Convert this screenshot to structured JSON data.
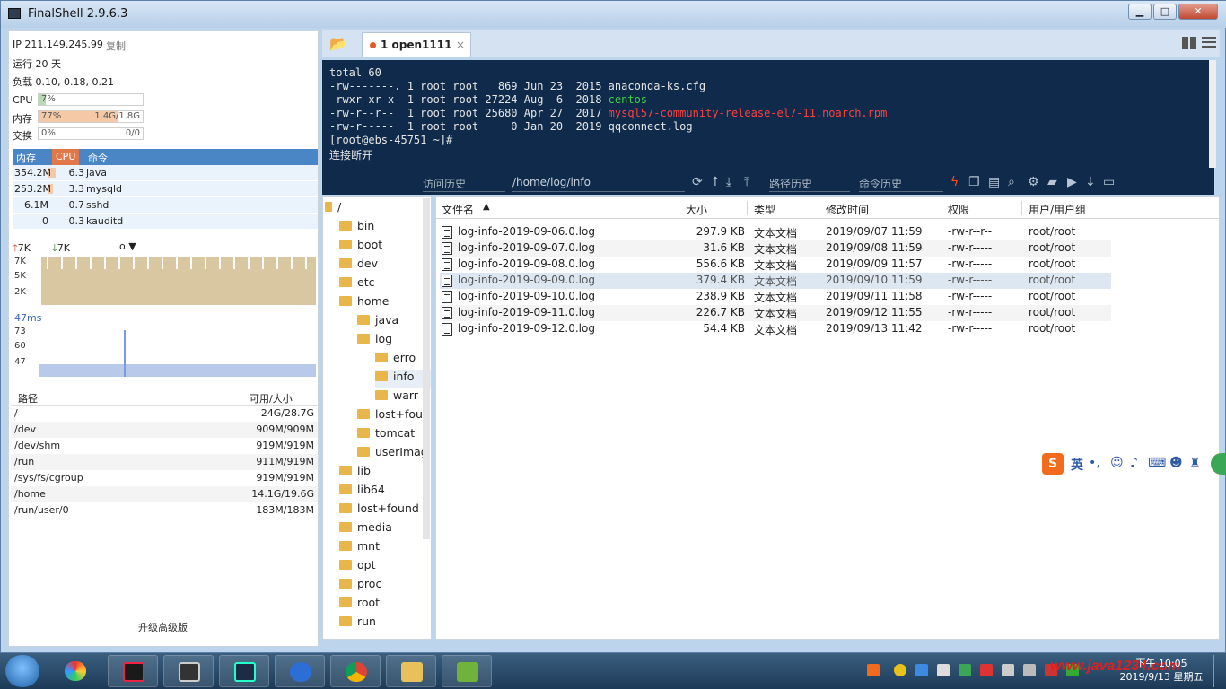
{
  "window": {
    "title": "FinalShell 2.9.6.3"
  },
  "status": {
    "ip": "IP 211.149.245.99",
    "copy": "复制",
    "uptime": "运行 20 天",
    "load": "负载 0.10, 0.18, 0.21",
    "cpu": {
      "label": "CPU",
      "value": "7%",
      "fraction": 0.07
    },
    "mem": {
      "label": "内存",
      "percent": "77%",
      "usage": "1.4G/1.8G",
      "fraction": 0.77
    },
    "swap": {
      "label": "交换",
      "percent": "0%",
      "usage": "0/0",
      "fraction": 0
    }
  },
  "processes": {
    "headers": [
      "内存",
      "CPU",
      "命令"
    ],
    "rows": [
      {
        "mem": "354.2M",
        "cpu": "6.3",
        "cmd": "java"
      },
      {
        "mem": "253.2M",
        "cpu": "3.3",
        "cmd": "mysqld"
      },
      {
        "mem": "6.1M",
        "cpu": "0.7",
        "cmd": "sshd"
      },
      {
        "mem": "0",
        "cpu": "0.3",
        "cmd": "kauditd"
      }
    ]
  },
  "network": {
    "up": "7K",
    "down": "7K",
    "iface": "lo",
    "y_labels": [
      "7K",
      "5K",
      "2K"
    ],
    "ping": "47ms",
    "ping_labels": [
      "73",
      "60",
      "47"
    ]
  },
  "disks": {
    "headers": [
      "路径",
      "可用/大小"
    ],
    "rows": [
      {
        "path": "/",
        "size": "24G/28.7G"
      },
      {
        "path": "/dev",
        "size": "909M/909M"
      },
      {
        "path": "/dev/shm",
        "size": "919M/919M"
      },
      {
        "path": "/run",
        "size": "911M/919M"
      },
      {
        "path": "/sys/fs/cgroup",
        "size": "919M/919M"
      },
      {
        "path": "/home",
        "size": "14.1G/19.6G"
      },
      {
        "path": "/run/user/0",
        "size": "183M/183M"
      }
    ],
    "upgrade": "升级高级版"
  },
  "tab": {
    "label": "1 open1111",
    "close": "×"
  },
  "terminal": {
    "lines": [
      {
        "pre": "total 60",
        "name": "",
        "cls": ""
      },
      {
        "pre": "-rw-------. 1 root root   869 Jun 23  2015 ",
        "name": "anaconda-ks.cfg",
        "cls": ""
      },
      {
        "pre": "-rwxr-xr-x  1 root root 27224 Aug  6  2018 ",
        "name": "centos",
        "cls": "t-green"
      },
      {
        "pre": "-rw-r--r--  1 root root 25680 Apr 27  2017 ",
        "name": "mysql57-community-release-el7-11.noarch.rpm",
        "cls": "t-red"
      },
      {
        "pre": "-rw-r-----  1 root root     0 Jan 20  2019 ",
        "name": "qqconnect.log",
        "cls": ""
      },
      {
        "pre": "[root@ebs-45751 ~]#",
        "name": "",
        "cls": ""
      },
      {
        "pre": "连接断开",
        "name": "",
        "cls": ""
      }
    ]
  },
  "toolbar": {
    "history": "访问历史",
    "path": "/home/log/info",
    "path_history": "路径历史",
    "cmd_history": "命令历史"
  },
  "tree": {
    "root": "/",
    "items": [
      {
        "label": "bin",
        "level": 1
      },
      {
        "label": "boot",
        "level": 1
      },
      {
        "label": "dev",
        "level": 1
      },
      {
        "label": "etc",
        "level": 1
      },
      {
        "label": "home",
        "level": 1
      },
      {
        "label": "java",
        "level": 2
      },
      {
        "label": "log",
        "level": 2
      },
      {
        "label": "erro",
        "level": 3
      },
      {
        "label": "info",
        "level": 3
      },
      {
        "label": "warr",
        "level": 3
      },
      {
        "label": "lost+fou",
        "level": 2
      },
      {
        "label": "tomcat",
        "level": 2
      },
      {
        "label": "userImag",
        "level": 2
      },
      {
        "label": "lib",
        "level": 1
      },
      {
        "label": "lib64",
        "level": 1
      },
      {
        "label": "lost+found",
        "level": 1
      },
      {
        "label": "media",
        "level": 1
      },
      {
        "label": "mnt",
        "level": 1
      },
      {
        "label": "opt",
        "level": 1
      },
      {
        "label": "proc",
        "level": 1
      },
      {
        "label": "root",
        "level": 1
      },
      {
        "label": "run",
        "level": 1
      }
    ]
  },
  "files": {
    "headers": [
      "文件名",
      "大小",
      "类型",
      "修改时间",
      "权限",
      "用户/用户组"
    ],
    "rows": [
      {
        "name": "log-info-2019-09-06.0.log",
        "size": "297.9 KB",
        "type": "文本文档",
        "mtime": "2019/09/07 11:59",
        "perm": "-rw-r--r--",
        "owner": "root/root"
      },
      {
        "name": "log-info-2019-09-07.0.log",
        "size": "31.6 KB",
        "type": "文本文档",
        "mtime": "2019/09/08 11:59",
        "perm": "-rw-r-----",
        "owner": "root/root"
      },
      {
        "name": "log-info-2019-09-08.0.log",
        "size": "556.6 KB",
        "type": "文本文档",
        "mtime": "2019/09/09 11:57",
        "perm": "-rw-r-----",
        "owner": "root/root"
      },
      {
        "name": "log-info-2019-09-09.0.log",
        "size": "379.4 KB",
        "type": "文本文档",
        "mtime": "2019/09/10 11:59",
        "perm": "-rw-r-----",
        "owner": "root/root"
      },
      {
        "name": "log-info-2019-09-10.0.log",
        "size": "238.9 KB",
        "type": "文本文档",
        "mtime": "2019/09/11 11:58",
        "perm": "-rw-r-----",
        "owner": "root/root"
      },
      {
        "name": "log-info-2019-09-11.0.log",
        "size": "226.7 KB",
        "type": "文本文档",
        "mtime": "2019/09/12 11:55",
        "perm": "-rw-r-----",
        "owner": "root/root"
      },
      {
        "name": "log-info-2019-09-12.0.log",
        "size": "54.4 KB",
        "type": "文本文档",
        "mtime": "2019/09/13 11:42",
        "perm": "-rw-r-----",
        "owner": "root/root"
      }
    ]
  },
  "ime": {
    "label": "英",
    "punct": "•,"
  },
  "clock": {
    "time": "下午 10:05",
    "date": "2019/9/13 星期五"
  },
  "watermark": "www.java1234.com",
  "colors": {
    "accent": "#4a86c5",
    "terminal_bg": "#0f2a4a",
    "term_green": "#3fd23f",
    "term_red": "#ff4040"
  }
}
